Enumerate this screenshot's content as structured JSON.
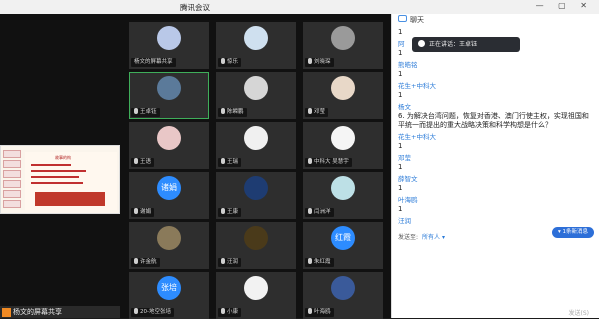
{
  "window": {
    "title": "腾讯会议",
    "controls": "— ▢ ✕"
  },
  "share": {
    "presenter_label": "杨文的屏幕共享",
    "slide_title": "故事的构"
  },
  "tiles": [
    {
      "name": "杨文的屏幕共享",
      "avatar": "",
      "av_color": "#b9c8e8",
      "has_mic": false,
      "col": 0,
      "row": 0
    },
    {
      "name": "惊乐",
      "avatar": "",
      "av_color": "#cfe0ef",
      "has_mic": true,
      "col": 1,
      "row": 0
    },
    {
      "name": "刘晓琛",
      "avatar": "",
      "av_color": "#9a9a9a",
      "has_mic": true,
      "col": 2,
      "row": 0
    },
    {
      "name": "王卓钰",
      "avatar": "",
      "av_color": "#5b7a9a",
      "has_mic": true,
      "col": 0,
      "row": 1,
      "active": true
    },
    {
      "name": "陈瞬鹏",
      "avatar": "",
      "av_color": "#d6d6d6",
      "has_mic": true,
      "col": 1,
      "row": 1
    },
    {
      "name": "邓莹",
      "avatar": "",
      "av_color": "#e8d8c8",
      "has_mic": true,
      "col": 2,
      "row": 1
    },
    {
      "name": "王语",
      "avatar": "",
      "av_color": "#e9c7c7",
      "has_mic": true,
      "col": 0,
      "row": 2
    },
    {
      "name": "王瑞",
      "avatar": "",
      "av_color": "#f0f0f0",
      "has_mic": true,
      "col": 1,
      "row": 2
    },
    {
      "name": "中科大 吴慧宇",
      "avatar": "",
      "av_color": "#f5f5f5",
      "has_mic": true,
      "col": 2,
      "row": 2
    },
    {
      "name": "谢娟",
      "avatar": "诸娟",
      "av_color": "#2d8cff",
      "has_mic": true,
      "col": 0,
      "row": 3
    },
    {
      "name": "王康",
      "avatar": "",
      "av_color": "#1e3c72",
      "has_mic": true,
      "col": 1,
      "row": 3
    },
    {
      "name": "闫洲洋",
      "avatar": "",
      "av_color": "#bde0e6",
      "has_mic": true,
      "col": 2,
      "row": 3
    },
    {
      "name": "许金航",
      "avatar": "",
      "av_color": "#8a7a5a",
      "has_mic": true,
      "col": 0,
      "row": 4
    },
    {
      "name": "汪润",
      "avatar": "",
      "av_color": "#4a3a1a",
      "has_mic": true,
      "col": 1,
      "row": 4
    },
    {
      "name": "朱红霞",
      "avatar": "红霞",
      "av_color": "#2d8cff",
      "has_mic": true,
      "col": 2,
      "row": 4
    },
    {
      "name": "20-地空张培",
      "avatar": "张培",
      "av_color": "#2d8cff",
      "has_mic": true,
      "col": 0,
      "row": 5
    },
    {
      "name": "小康",
      "avatar": "",
      "av_color": "#f2f2f2",
      "has_mic": true,
      "col": 1,
      "row": 5
    },
    {
      "name": "叶海鸥",
      "avatar": "",
      "av_color": "#3a5a9a",
      "has_mic": true,
      "col": 2,
      "row": 5
    }
  ],
  "chat": {
    "header": "聊天",
    "speaking": "正在讲话：王卓钰",
    "messages": [
      {
        "who": "",
        "text": "1"
      },
      {
        "who": "阿",
        "text": "1"
      },
      {
        "who": "熊皓铭",
        "text": "1"
      },
      {
        "who": "花生+中科大",
        "text": "1"
      },
      {
        "who": "杨文",
        "text": "6.     为解决台湾问题，恢复对香港、澳门行使主权，实现祖国和平统一而提出的重大战略决策和科学构想是什么？"
      },
      {
        "who": "花生+中科大",
        "text": "1"
      },
      {
        "who": "邓莹",
        "text": "1"
      },
      {
        "who": "薛智文",
        "text": "1"
      },
      {
        "who": "叶海鸥",
        "text": "1"
      },
      {
        "who": "汪润",
        "text": ""
      }
    ],
    "new_msg": "▾ 1条新消息",
    "send_to_label": "发送至:",
    "send_to_value": "所有人 ▾",
    "send_button": "发送(S)"
  }
}
